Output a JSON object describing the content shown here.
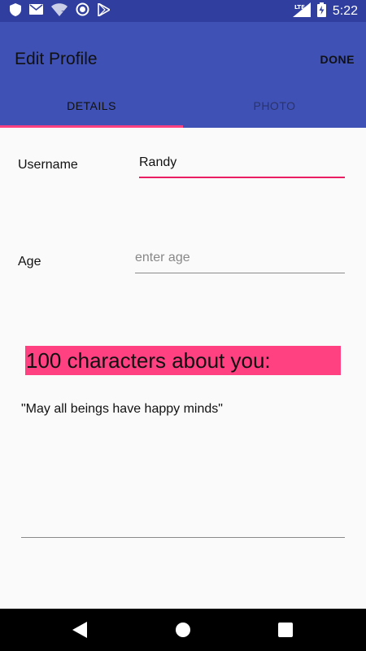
{
  "status_bar": {
    "time": "5:22",
    "network": "LTE",
    "icons": [
      "shield-icon",
      "mail-icon",
      "wifi-unknown-icon",
      "circle-icon",
      "play-store-icon",
      "signal-icon",
      "battery-charging-icon"
    ]
  },
  "app_bar": {
    "title": "Edit Profile",
    "done_label": "DONE"
  },
  "tabs": [
    {
      "label": "DETAILS",
      "active": true
    },
    {
      "label": "PHOTO",
      "active": false
    }
  ],
  "form": {
    "username": {
      "label": "Username",
      "value": "Randy"
    },
    "age": {
      "label": "Age",
      "value": "",
      "placeholder": "enter age"
    }
  },
  "about": {
    "heading": "100 characters about you:",
    "text": "\"May all beings have happy minds\""
  },
  "colors": {
    "primary": "#3f51b5",
    "primary_dark": "#303f9f",
    "accent": "#ff4081"
  },
  "nav_bar": {
    "icons": [
      "back-icon",
      "home-icon",
      "recents-icon"
    ]
  }
}
